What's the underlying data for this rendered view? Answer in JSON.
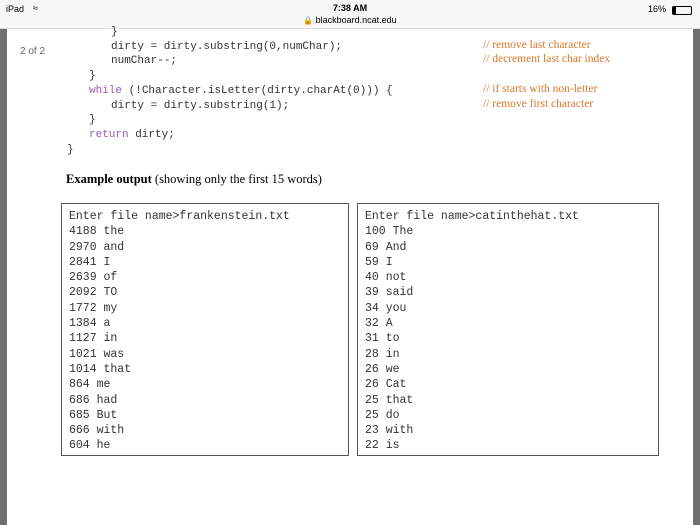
{
  "status_bar": {
    "device": "iPad",
    "time": "7:38 AM",
    "url": "blackboard.ncat.edu",
    "battery": "16%"
  },
  "page_indicator": "2 of 2",
  "code": [
    {
      "text": "}",
      "indent": 2
    },
    {
      "text": "dirty = dirty.substring(0,numChar);",
      "indent": 2,
      "comment": "// remove last character"
    },
    {
      "text": "numChar--;",
      "indent": 2,
      "comment": "// decrement last char index"
    },
    {
      "text": "}",
      "indent": 1
    },
    {
      "keyword": "while",
      "text": " (!Character.isLetter(dirty.charAt(0))) {",
      "indent": 1,
      "comment": "// if starts with non-letter"
    },
    {
      "text": "dirty = dirty.substring(1);",
      "indent": 2,
      "comment": "// remove first character"
    },
    {
      "text": "}",
      "indent": 1
    },
    {
      "keyword": "return",
      "text": " dirty;",
      "indent": 1
    },
    {
      "text": "}",
      "indent": 0
    }
  ],
  "example": {
    "bold": "Example output",
    "rest": " (showing only the first 15 words)"
  },
  "outputs": [
    {
      "prompt": "Enter file name>frankenstein.txt",
      "lines": [
        "4188 the",
        "2970 and",
        "2841 I",
        "2639 of",
        "2092 TO",
        "1772 my",
        "1384 a",
        "1127 in",
        "1021 was",
        "1014 that",
        "864 me",
        "686 had",
        "685 But",
        "666 with",
        "604 he"
      ]
    },
    {
      "prompt": "Enter file name>catinthehat.txt",
      "lines": [
        "100 The",
        "69 And",
        "59 I",
        "40 not",
        "39 said",
        "34 you",
        "32 A",
        "31 to",
        "28 in",
        "26 we",
        "26 Cat",
        "25 that",
        "25 do",
        "23 with",
        "22 is"
      ]
    }
  ]
}
